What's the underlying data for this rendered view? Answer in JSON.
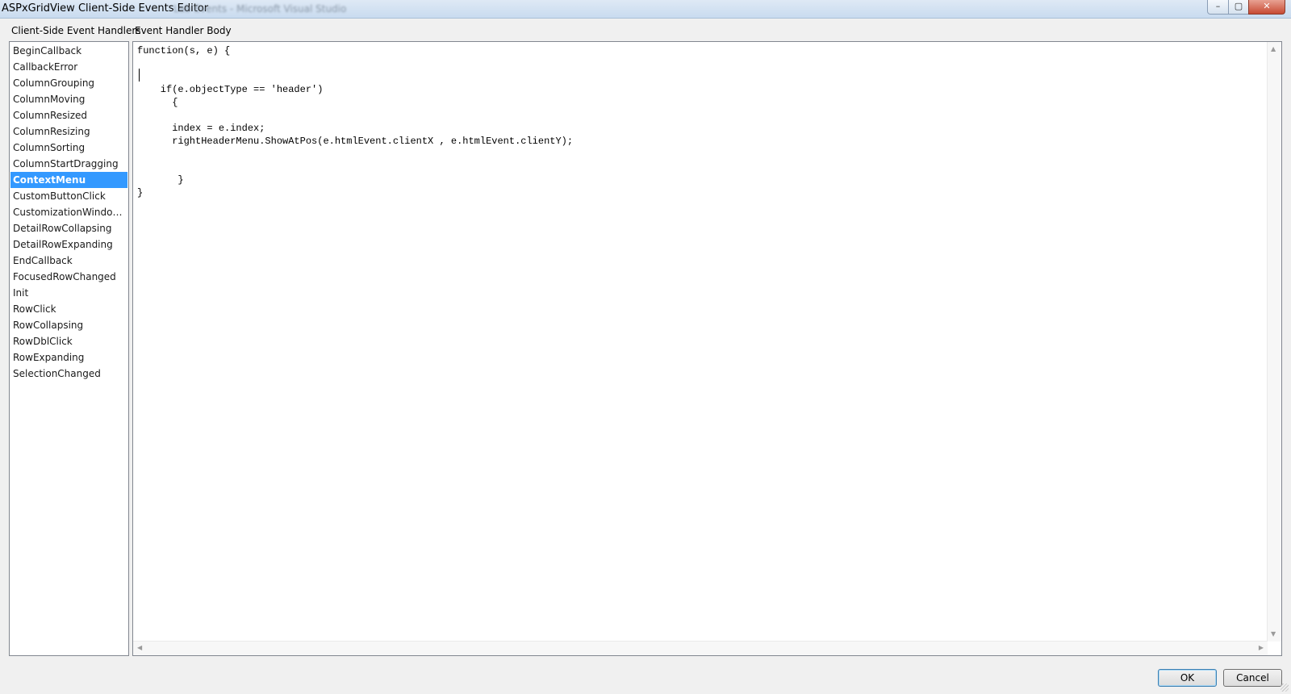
{
  "window": {
    "title": "ASPxGridView Client-Side Events Editor",
    "background_title": "Lab Events - Microsoft Visual Studio",
    "controls": {
      "minimize": "–",
      "maximize": "▢",
      "close": "✕"
    }
  },
  "labels": {
    "handlers": "Client-Side Event Handlers",
    "body": "Event Handler Body"
  },
  "handlers": [
    "BeginCallback",
    "CallbackError",
    "ColumnGrouping",
    "ColumnMoving",
    "ColumnResized",
    "ColumnResizing",
    "ColumnSorting",
    "ColumnStartDragging",
    "ContextMenu",
    "CustomButtonClick",
    "CustomizationWindowC...",
    "DetailRowCollapsing",
    "DetailRowExpanding",
    "EndCallback",
    "FocusedRowChanged",
    "Init",
    "RowClick",
    "RowCollapsing",
    "RowDblClick",
    "RowExpanding",
    "SelectionChanged"
  ],
  "selected_handler": "ContextMenu",
  "code_lines": [
    "function(s, e) {",
    "",
    "",
    "    if(e.objectType == 'header')",
    "      {",
    "",
    "      index = e.index;",
    "      rightHeaderMenu.ShowAtPos(e.htmlEvent.clientX , e.htmlEvent.clientY);",
    "",
    "",
    "       }",
    "}"
  ],
  "buttons": {
    "ok": "OK",
    "cancel": "Cancel"
  },
  "colors": {
    "selection": "#3399ff",
    "title_bar": "#dfe9f5",
    "close_button": "#c74a33"
  }
}
